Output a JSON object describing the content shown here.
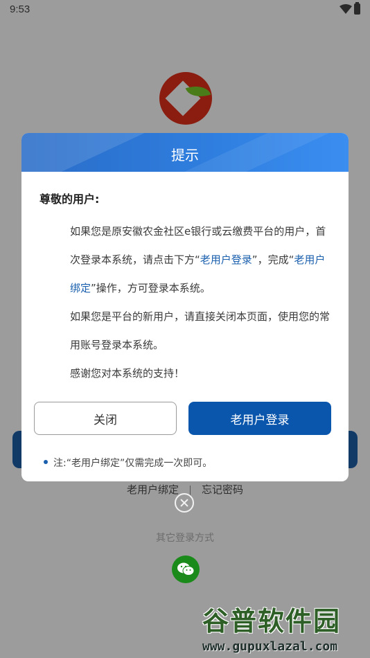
{
  "status_bar": {
    "time": "9:53"
  },
  "background_page": {
    "links": {
      "old_user_bind": "老用户绑定",
      "forgot_password": "忘记密码"
    },
    "other_login": "其它登录方式",
    "wechat_icon": "wechat-icon"
  },
  "dialog": {
    "title": "提示",
    "greeting": "尊敬的用户:",
    "p1_a": "如果您是原安徽农金社区e银行或云缴费平台的用户，首次登录本系统，请点击下方“",
    "p1_link1": "老用户登录",
    "p1_b": "”，完成“",
    "p1_link2": "老用户绑定",
    "p1_c": "”操作，方可登录本系统。",
    "p2": "如果您是平台的新用户，请直接关闭本页面，使用您的常用账号登录本系统。",
    "p3": "感谢您对本系统的支持！",
    "close_button": "关闭",
    "login_button": "老用户登录",
    "note": "注:“老用户绑定”仅需完成一次即可。"
  },
  "watermark": {
    "title": "谷普软件园",
    "url": "www.gupuxlazal.com"
  },
  "colors": {
    "primary": "#0a56ad",
    "header_gradient_start": "#2a6cc7",
    "link": "#1a5fae",
    "wechat": "#1a8a1a"
  }
}
